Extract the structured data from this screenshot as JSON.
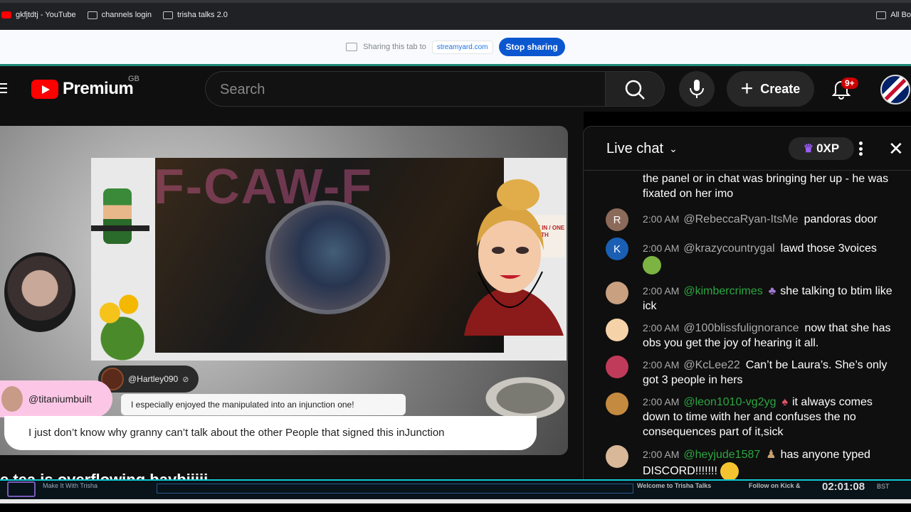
{
  "bookmarks": [
    {
      "label": "gkfjtdtj - YouTube",
      "icon": "youtube-icon"
    },
    {
      "label": "channels login",
      "icon": "folder-icon"
    },
    {
      "label": "trisha talks 2.0",
      "icon": "folder-icon"
    }
  ],
  "bookmarks_right": "All Bo",
  "share": {
    "text": "Sharing this tab to",
    "domain": "streamyard.com",
    "stop_label": "Stop sharing"
  },
  "youtube": {
    "logo_text": "Premium",
    "region": "GB",
    "search_placeholder": "Search",
    "create_label": "Create",
    "notifications": "9+"
  },
  "video": {
    "overlay_brand": "F-CAW-F",
    "sign_text": "OUT ROOT IN / ONE TWO TH",
    "comment1": {
      "author": "@Hartley090",
      "text": "I especially enjoyed the manipulated into an injunction one!"
    },
    "comment2": {
      "author": "@titaniumbuilt",
      "text": "I just don’t know why granny can’t talk about the other People that signed this inJunction"
    },
    "title_partial": "e tea is overflowing baybiiiii"
  },
  "ticker": {
    "left_text": "Make It With Trisha",
    "welcome": "Welcome to Trisha Talks",
    "follow": "Follow on Kick &",
    "clock": "02:01:08",
    "tz": "BST"
  },
  "chat": {
    "title": "Live chat",
    "xp": "0XP",
    "messages": [
      {
        "time": "",
        "author": "",
        "text": "the panel or in chat was bringing her up - he was fixated on her imo",
        "avatar": "",
        "member": false
      },
      {
        "time": "2:00 AM",
        "author": "@RebeccaRyan-ItsMe",
        "text": "pandoras door",
        "avatar": "R",
        "member": false
      },
      {
        "time": "2:00 AM",
        "author": "@krazycountrygal",
        "text": "lawd those 3voices",
        "avatar": "K",
        "member": false
      },
      {
        "time": "2:00 AM",
        "author": "@kimbercrimes",
        "text": "she talking to btim like ick",
        "avatar": "",
        "member": true
      },
      {
        "time": "2:00 AM",
        "author": "@100blissfulignorance",
        "text": "now that she has obs you get the joy of hearing it all.",
        "avatar": "",
        "member": false
      },
      {
        "time": "2:00 AM",
        "author": "@KcLee22",
        "text": "Can’t be Laura’s. She’s only got 3 people in hers",
        "avatar": "",
        "member": false
      },
      {
        "time": "2:00 AM",
        "author": "@leon1010-vg2yg",
        "text": "it always comes down to time with her and confuses the no consequences part of it,sick",
        "avatar": "",
        "member": true
      },
      {
        "time": "2:00 AM",
        "author": "@heyjude1587",
        "text": "has anyone typed DISCORD!!!!!!!",
        "avatar": "",
        "member": true
      }
    ]
  },
  "colors": {
    "yt_red": "#ff0000",
    "member_green": "#2ba640",
    "share_blue": "#0b57d0"
  }
}
